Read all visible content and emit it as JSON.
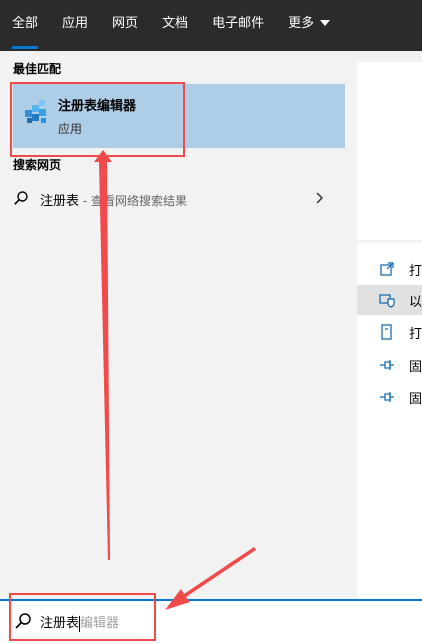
{
  "tabs": [
    {
      "label": "全部",
      "active": true
    },
    {
      "label": "应用",
      "active": false
    },
    {
      "label": "网页",
      "active": false
    },
    {
      "label": "文档",
      "active": false
    },
    {
      "label": "电子邮件",
      "active": false
    },
    {
      "label": "更多",
      "active": false
    }
  ],
  "best_match": {
    "section_title": "最佳匹配",
    "name": "注册表编辑器",
    "type": "应用",
    "icon": "regedit-icon"
  },
  "web_search": {
    "section_title": "搜索网页",
    "query": "注册表",
    "suffix": " - 查看网络搜索结果",
    "icon": "search-icon"
  },
  "actions": [
    {
      "label": "打",
      "icon": "open-icon"
    },
    {
      "label": "以",
      "icon": "run-as-admin-icon"
    },
    {
      "label": "打",
      "icon": "open-file-location-icon"
    },
    {
      "label": "固",
      "icon": "pin-icon"
    },
    {
      "label": "固",
      "icon": "pin-icon"
    }
  ],
  "search": {
    "typed": "注册表",
    "suggestion": "编辑器"
  },
  "colors": {
    "tabbar": "#2b2b2b",
    "accent": "#0078d7",
    "selected": "#aecde7",
    "annotation": "#f04a4a"
  }
}
